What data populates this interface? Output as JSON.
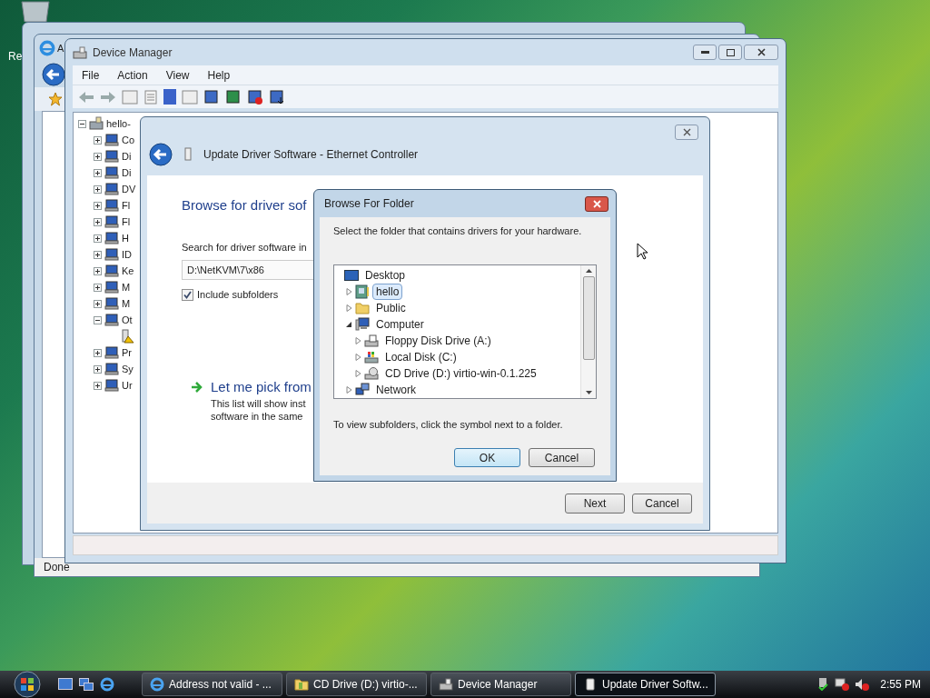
{
  "desktop": {
    "icon_label": "Re"
  },
  "back_window": {
    "title": "A",
    "status": "Done"
  },
  "device_manager": {
    "title": "Device Manager",
    "menu": [
      "File",
      "Action",
      "View",
      "Help"
    ],
    "tree": {
      "label": "hello-",
      "kind": "computer",
      "expanded": true,
      "children": [
        {
          "label": "Co",
          "kind": "category",
          "expanded": false
        },
        {
          "label": "Di",
          "kind": "category",
          "expanded": false
        },
        {
          "label": "Di",
          "kind": "category",
          "expanded": false
        },
        {
          "label": "DV",
          "kind": "category",
          "expanded": false
        },
        {
          "label": "Fl",
          "kind": "category",
          "expanded": false
        },
        {
          "label": "Fl",
          "kind": "category",
          "expanded": false
        },
        {
          "label": "H",
          "kind": "category",
          "expanded": false
        },
        {
          "label": "ID",
          "kind": "category",
          "expanded": false
        },
        {
          "label": "Ke",
          "kind": "category",
          "expanded": false
        },
        {
          "label": "M",
          "kind": "category",
          "expanded": false
        },
        {
          "label": "M",
          "kind": "category",
          "expanded": false
        },
        {
          "label": "Ot",
          "kind": "category",
          "expanded": true,
          "children": [
            {
              "kind": "warning"
            }
          ]
        },
        {
          "label": "Pr",
          "kind": "category",
          "expanded": false
        },
        {
          "label": "Sy",
          "kind": "category",
          "expanded": false
        },
        {
          "label": "Ur",
          "kind": "category",
          "expanded": false
        }
      ]
    }
  },
  "update_dialog": {
    "title": "Update Driver Software - Ethernet Controller",
    "heading": "Browse for driver sof",
    "search_label": "Search for driver software in",
    "path": "D:\\NetKVM\\7\\x86",
    "include_subfolders": {
      "label": "Include subfolders",
      "checked": true
    },
    "pick_link": "Let me pick from",
    "pick_description": [
      "This list will show inst",
      "software in the same"
    ],
    "buttons": [
      "Next",
      "Cancel"
    ]
  },
  "browse_dialog": {
    "title": "Browse For Folder",
    "instruction": "Select the folder that contains drivers for your hardware.",
    "tree": {
      "label": "Desktop",
      "kind": "desktop",
      "selected": false,
      "children": [
        {
          "label": "hello",
          "kind": "user",
          "expanded": false,
          "selected": true
        },
        {
          "label": "Public",
          "kind": "folder",
          "expanded": false,
          "selected": false
        },
        {
          "label": "Computer",
          "kind": "computer",
          "expanded": true,
          "selected": false,
          "children": [
            {
              "label": "Floppy Disk Drive (A:)",
              "kind": "floppy",
              "expanded": false,
              "selected": false
            },
            {
              "label": "Local Disk (C:)",
              "kind": "disk",
              "expanded": false,
              "selected": false
            },
            {
              "label": "CD Drive (D:) virtio-win-0.1.225",
              "kind": "cd",
              "expanded": false,
              "selected": false
            }
          ]
        },
        {
          "label": "Network",
          "kind": "network",
          "expanded": false,
          "selected": false
        }
      ]
    },
    "hint": "To view subfolders, click the symbol next to a folder.",
    "buttons": [
      {
        "label": "OK",
        "default": true
      },
      {
        "label": "Cancel",
        "default": false
      }
    ]
  },
  "taskbar": {
    "tasks": [
      {
        "label": "Address not valid - ...",
        "kind": "browser",
        "selected": false
      },
      {
        "label": "CD Drive (D:) virtio-...",
        "kind": "folder",
        "selected": false
      },
      {
        "label": "Device Manager",
        "kind": "device-manager",
        "selected": false
      },
      {
        "label": "Update Driver Softw...",
        "kind": "driver",
        "selected": true
      }
    ],
    "clock": "2:55 PM"
  }
}
